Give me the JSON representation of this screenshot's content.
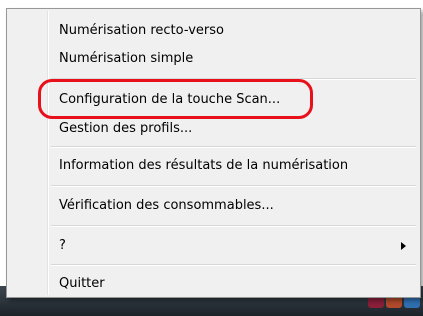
{
  "context_menu": {
    "items": [
      {
        "label": "Numérisation recto-verso",
        "has_submenu": false
      },
      {
        "label": "Numérisation simple",
        "has_submenu": false
      },
      {
        "label": "Configuration de la touche Scan...",
        "has_submenu": false,
        "highlighted": true
      },
      {
        "label": "Gestion des profils...",
        "has_submenu": false
      },
      {
        "label": "Information des résultats de la numérisation",
        "has_submenu": false
      },
      {
        "label": "Vérification des consommables...",
        "has_submenu": false
      },
      {
        "label": "?",
        "has_submenu": true
      },
      {
        "label": "Quitter",
        "has_submenu": false
      }
    ]
  },
  "annotation": {
    "color": "#e8101a",
    "highlights_item": "Configuration de la touche Scan..."
  },
  "taskbar": {
    "tray_icons": [
      "scanner-tray-icon",
      "app-tray-icon",
      "network-tray-icon"
    ]
  }
}
